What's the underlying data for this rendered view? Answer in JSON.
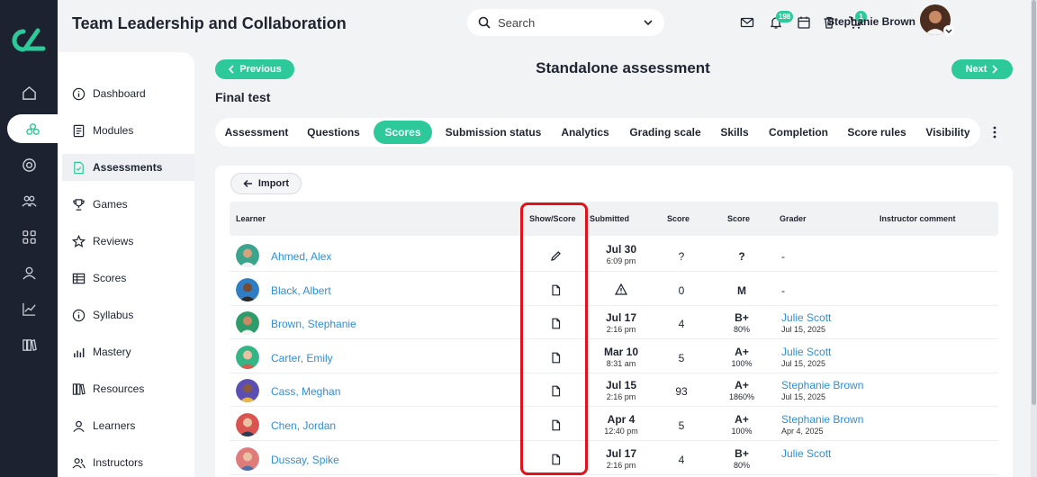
{
  "header": {
    "title": "Team Leadership and Collaboration",
    "search_placeholder": "Search",
    "notification_count": "198",
    "cart_count": "1",
    "user_name": "Stephanie Brown"
  },
  "sidebar": {
    "items": [
      {
        "label": "Dashboard",
        "icon": "info-icon"
      },
      {
        "label": "Modules",
        "icon": "book-icon"
      },
      {
        "label": "Assessments",
        "icon": "file-check-icon"
      },
      {
        "label": "Games",
        "icon": "trophy-icon"
      },
      {
        "label": "Reviews",
        "icon": "star-icon"
      },
      {
        "label": "Scores",
        "icon": "table-icon"
      },
      {
        "label": "Syllabus",
        "icon": "info-icon"
      },
      {
        "label": "Mastery",
        "icon": "bar-chart-icon"
      },
      {
        "label": "Resources",
        "icon": "books-icon"
      },
      {
        "label": "Learners",
        "icon": "user-icon"
      },
      {
        "label": "Instructors",
        "icon": "users-icon"
      }
    ]
  },
  "nav": {
    "previous_label": "Previous",
    "next_label": "Next"
  },
  "page": {
    "title": "Standalone assessment",
    "section_title": "Final test"
  },
  "tabs": [
    "Assessment",
    "Questions",
    "Scores",
    "Submission status",
    "Analytics",
    "Grading scale",
    "Skills",
    "Completion",
    "Score rules",
    "Visibility"
  ],
  "active_tab": "Scores",
  "toolbar": {
    "import_label": "Import"
  },
  "table": {
    "headers": {
      "learner": "Learner",
      "show_score": "Show/Score",
      "submitted": "Submitted",
      "score": "Score",
      "score2": "Score",
      "grader": "Grader",
      "comment": "Instructor comment"
    },
    "rows": [
      {
        "learner": "Ahmed, Alex",
        "action_icon": "pencil-icon",
        "date": "Jul 30",
        "time": "6:09 pm",
        "score": "?",
        "grade": "?",
        "pct": "",
        "grader": "-",
        "grader_date": "",
        "avatar_color": "#3aa58c"
      },
      {
        "learner": "Black, Albert",
        "action_icon": "file-icon",
        "date": "",
        "time": "",
        "warn_icon": "warning-icon",
        "score": "0",
        "grade": "M",
        "pct": "",
        "grader": "-",
        "grader_date": "",
        "avatar_color": "#2f7ec4"
      },
      {
        "learner": "Brown, Stephanie",
        "action_icon": "file-icon",
        "date": "Jul 17",
        "time": "2:16 pm",
        "score": "4",
        "grade": "B+",
        "pct": "80%",
        "grader": "Julie Scott",
        "grader_date": "Jul 15, 2025",
        "avatar_color": "#2e9b6a"
      },
      {
        "learner": "Carter, Emily",
        "action_icon": "file-icon",
        "date": "Mar 10",
        "time": "8:31 am",
        "score": "5",
        "grade": "A+",
        "pct": "100%",
        "grader": "Julie Scott",
        "grader_date": "Jul 15, 2025",
        "avatar_color": "#35b486"
      },
      {
        "learner": "Cass, Meghan",
        "action_icon": "file-icon",
        "date": "Jul 15",
        "time": "2:16 pm",
        "score": "93",
        "grade": "A+",
        "pct": "1860%",
        "grader": "Stephanie Brown",
        "grader_date": "Jul 15, 2025",
        "avatar_color": "#5b4fb3"
      },
      {
        "learner": "Chen, Jordan",
        "action_icon": "file-icon",
        "date": "Apr 4",
        "time": "12:40 pm",
        "score": "5",
        "grade": "A+",
        "pct": "100%",
        "grader": "Stephanie Brown",
        "grader_date": "Apr 4, 2025",
        "avatar_color": "#d9534f"
      },
      {
        "learner": "Dussay, Spike",
        "action_icon": "file-icon",
        "date": "Jul 17",
        "time": "2:16 pm",
        "score": "4",
        "grade": "B+",
        "pct": "80%",
        "grader": "Julie Scott",
        "grader_date": "",
        "avatar_color": "#e07b7b"
      }
    ]
  },
  "colors": {
    "accent": "#2ec99b",
    "link": "#2f8fd6",
    "rail": "#1c2230",
    "highlight": "#e0121b"
  }
}
